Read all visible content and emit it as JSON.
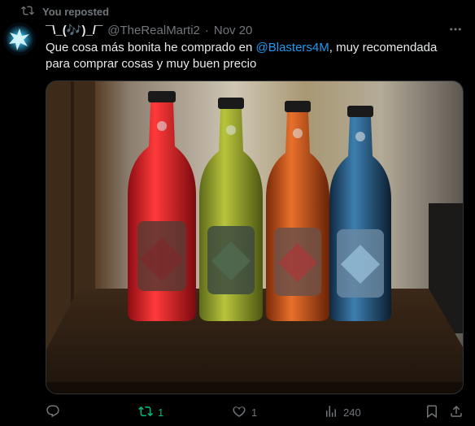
{
  "repost_banner": {
    "text": "You reposted",
    "icon": "repost-icon"
  },
  "tweet": {
    "display_name": "¯\\_(🎶)_/¯",
    "handle": "@TheRealMarti2",
    "separator": "·",
    "date": "Nov 20",
    "text_before": "Que cosa más bonita he comprado en ",
    "mention": "@Blasters4M",
    "text_after": ", muy recomendada para comprar cosas y muy buen precio",
    "media_description_icon": "photo-four-bottles"
  },
  "actions": {
    "reply": {
      "icon": "reply-icon",
      "count": ""
    },
    "repost": {
      "icon": "repost-icon",
      "count": "1",
      "color": "#00ba7c"
    },
    "like": {
      "icon": "heart-icon",
      "count": "1"
    },
    "views": {
      "icon": "views-icon",
      "count": "240"
    },
    "bookmark": {
      "icon": "bookmark-icon"
    },
    "share": {
      "icon": "share-icon"
    }
  },
  "colors": {
    "background": "#000000",
    "text": "#e7e9ea",
    "muted": "#71767b",
    "link": "#1d9bf0",
    "repost_active": "#00ba7c"
  }
}
